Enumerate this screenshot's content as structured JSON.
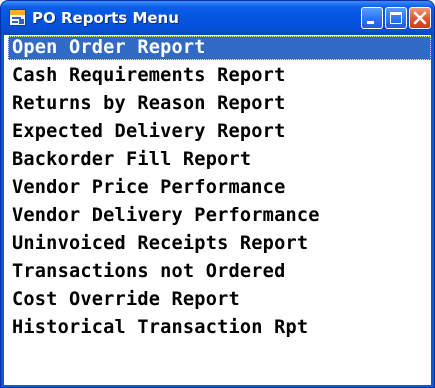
{
  "window": {
    "title": "PO Reports Menu",
    "controls": {
      "minimize": "minimize-icon",
      "maximize": "maximize-icon",
      "close": "close-icon"
    }
  },
  "menu": {
    "selected_index": 0,
    "items": [
      "Open Order Report",
      "Cash Requirements Report",
      "Returns by Reason Report",
      "Expected Delivery Report",
      "Backorder Fill Report",
      "Vendor Price Performance",
      "Vendor Delivery Performance",
      "Uninvoiced Receipts Report",
      "Transactions not Ordered",
      "Cost Override Report",
      "Historical Transaction Rpt"
    ]
  },
  "colors": {
    "titlebar": "#0555e0",
    "selection": "#316ac5",
    "close_button": "#e0542a"
  }
}
